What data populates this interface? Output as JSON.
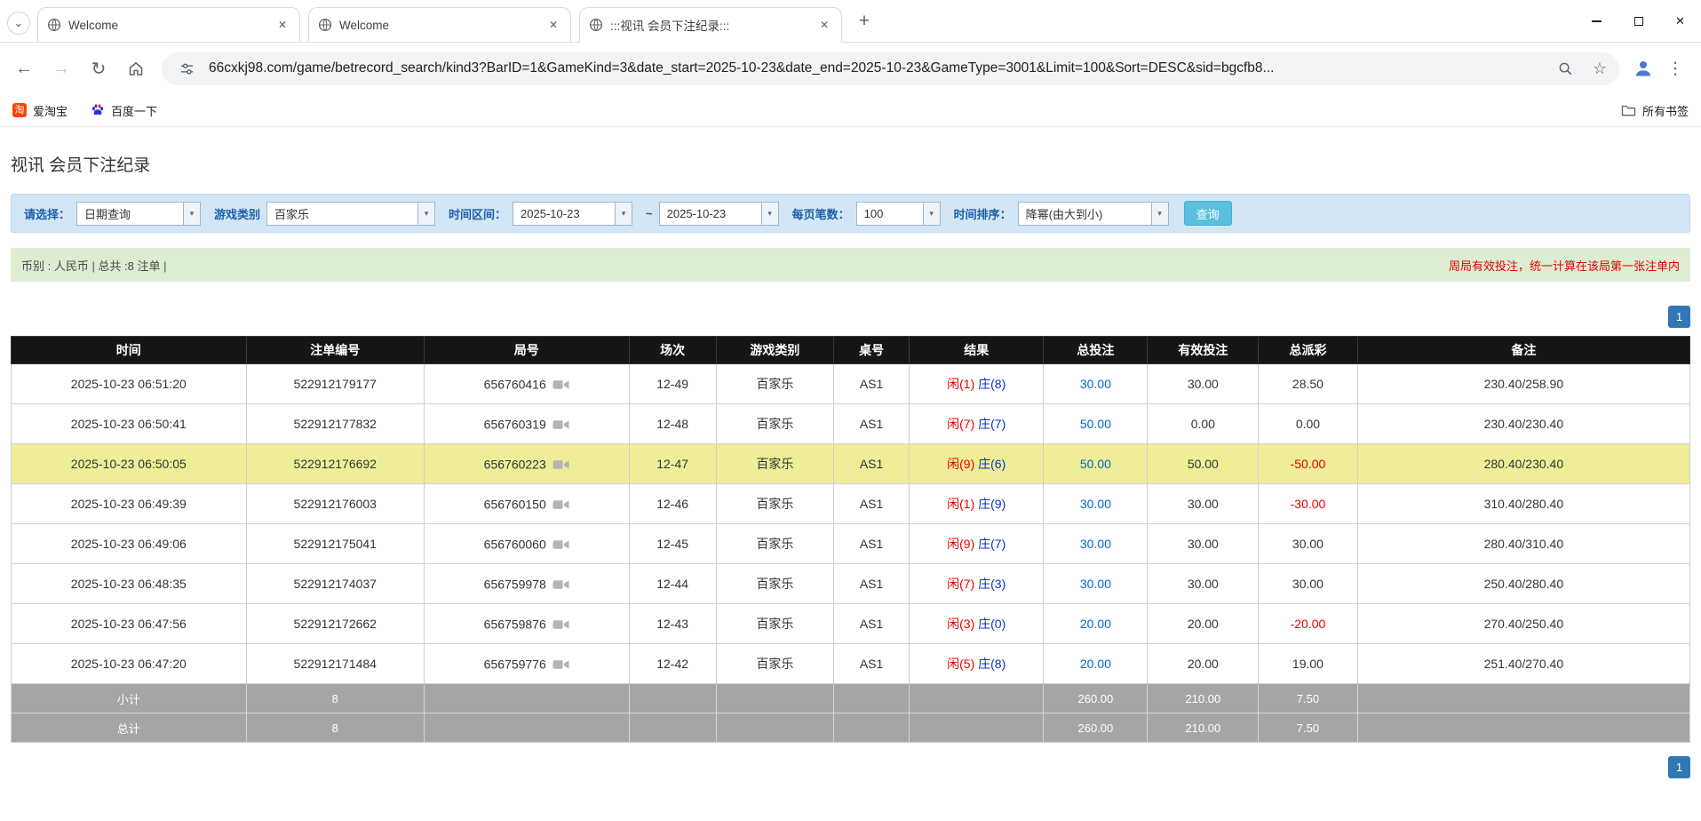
{
  "icons": {
    "tab_search": "⌄",
    "tab_close": "✕",
    "new_tab": "+",
    "window_close": "✕",
    "back": "←",
    "forward": "→",
    "refresh": "↻",
    "star": "☆",
    "menu": "⋮",
    "dropdown": "▾",
    "taobao_glyph": "淘"
  },
  "colors": {
    "highlight_row": "#f0ed98",
    "link_blue": "#0066cc",
    "negative_red": "#e60000",
    "player_red": "#e60000",
    "banker_blue": "#0033cc",
    "pager_blue": "#2f77b5",
    "filter_bar": "#d3e6f5",
    "info_bar_green": "#dcedd2",
    "header_black": "#151515",
    "summary_gray": "#a5a5a5"
  },
  "browser": {
    "tabs": [
      {
        "title": "Welcome"
      },
      {
        "title": "Welcome"
      },
      {
        "title": ":::视讯 会员下注纪录:::"
      }
    ],
    "url": "66cxkj98.com/game/betrecord_search/kind3?BarID=1&GameKind=3&date_start=2025-10-23&date_end=2025-10-23&GameType=3001&Limit=100&Sort=DESC&sid=bgcfb8...",
    "bookmarks": [
      {
        "label": "爱淘宝"
      },
      {
        "label": "百度一下"
      }
    ],
    "all_bookmarks_label": "所有书签"
  },
  "page": {
    "title": "视讯 会员下注纪录",
    "filters": {
      "select_label": "请选择：",
      "select_value": "日期查询",
      "game_type_label": "游戏类别",
      "game_type_value": "百家乐",
      "date_range_label": "时间区间：",
      "date_start": "2025-10-23",
      "date_separator": "~",
      "date_end": "2025-10-23",
      "page_size_label": "每页笔数：",
      "page_size_value": "100",
      "sort_label": "时间排序：",
      "sort_value": "降幂(由大到小)",
      "search_button": "查询"
    },
    "summary": {
      "left": "币别 : 人民币 | 总共 :8 注单 |",
      "right": "周局有效投注，统一计算在该局第一张注单内"
    },
    "pagination": "1",
    "table": {
      "headers": [
        "时间",
        "注单编号",
        "局号",
        "场次",
        "游戏类别",
        "桌号",
        "结果",
        "总投注",
        "有效投注",
        "总派彩",
        "备注"
      ],
      "rows": [
        {
          "time": "2025-10-23 06:51:20",
          "bet_id": "522912179177",
          "round_id": "656760416",
          "session": "12-49",
          "game": "百家乐",
          "table": "AS1",
          "result_player": "闲(1)",
          "result_banker": "庄(8)",
          "total_bet": "30.00",
          "valid_bet": "30.00",
          "payout": "28.50",
          "remark": "230.40/258.90",
          "highlight": false
        },
        {
          "time": "2025-10-23 06:50:41",
          "bet_id": "522912177832",
          "round_id": "656760319",
          "session": "12-48",
          "game": "百家乐",
          "table": "AS1",
          "result_player": "闲(7)",
          "result_banker": "庄(7)",
          "total_bet": "50.00",
          "valid_bet": "0.00",
          "payout": "0.00",
          "remark": "230.40/230.40",
          "highlight": false
        },
        {
          "time": "2025-10-23 06:50:05",
          "bet_id": "522912176692",
          "round_id": "656760223",
          "session": "12-47",
          "game": "百家乐",
          "table": "AS1",
          "result_player": "闲(9)",
          "result_banker": "庄(6)",
          "total_bet": "50.00",
          "valid_bet": "50.00",
          "payout": "-50.00",
          "remark": "280.40/230.40",
          "highlight": true
        },
        {
          "time": "2025-10-23 06:49:39",
          "bet_id": "522912176003",
          "round_id": "656760150",
          "session": "12-46",
          "game": "百家乐",
          "table": "AS1",
          "result_player": "闲(1)",
          "result_banker": "庄(9)",
          "total_bet": "30.00",
          "valid_bet": "30.00",
          "payout": "-30.00",
          "remark": "310.40/280.40",
          "highlight": false
        },
        {
          "time": "2025-10-23 06:49:06",
          "bet_id": "522912175041",
          "round_id": "656760060",
          "session": "12-45",
          "game": "百家乐",
          "table": "AS1",
          "result_player": "闲(9)",
          "result_banker": "庄(7)",
          "total_bet": "30.00",
          "valid_bet": "30.00",
          "payout": "30.00",
          "remark": "280.40/310.40",
          "highlight": false
        },
        {
          "time": "2025-10-23 06:48:35",
          "bet_id": "522912174037",
          "round_id": "656759978",
          "session": "12-44",
          "game": "百家乐",
          "table": "AS1",
          "result_player": "闲(7)",
          "result_banker": "庄(3)",
          "total_bet": "30.00",
          "valid_bet": "30.00",
          "payout": "30.00",
          "remark": "250.40/280.40",
          "highlight": false
        },
        {
          "time": "2025-10-23 06:47:56",
          "bet_id": "522912172662",
          "round_id": "656759876",
          "session": "12-43",
          "game": "百家乐",
          "table": "AS1",
          "result_player": "闲(3)",
          "result_banker": "庄(0)",
          "total_bet": "20.00",
          "valid_bet": "20.00",
          "payout": "-20.00",
          "remark": "270.40/250.40",
          "highlight": false
        },
        {
          "time": "2025-10-23 06:47:20",
          "bet_id": "522912171484",
          "round_id": "656759776",
          "session": "12-42",
          "game": "百家乐",
          "table": "AS1",
          "result_player": "闲(5)",
          "result_banker": "庄(8)",
          "total_bet": "20.00",
          "valid_bet": "20.00",
          "payout": "19.00",
          "remark": "251.40/270.40",
          "highlight": false
        }
      ],
      "subtotal": {
        "label": "小计",
        "count": "8",
        "total_bet": "260.00",
        "valid_bet": "210.00",
        "payout": "7.50"
      },
      "total": {
        "label": "总计",
        "count": "8",
        "total_bet": "260.00",
        "valid_bet": "210.00",
        "payout": "7.50"
      }
    }
  }
}
